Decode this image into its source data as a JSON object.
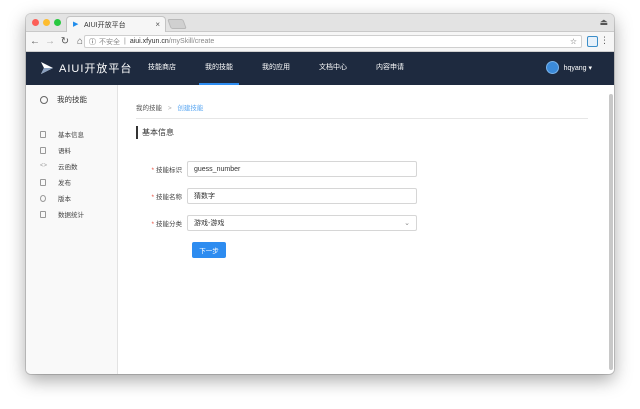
{
  "browser": {
    "tab_title": "AIUI开放平台",
    "tab_close": "×",
    "address": {
      "insecure_label": "不安全",
      "host": "aiui.xfyun.cn",
      "path": "/mySkill/create"
    }
  },
  "header": {
    "logo_text": "AIUI开放平台",
    "nav": [
      "技能商店",
      "我的技能",
      "我的应用",
      "文档中心",
      "内容申请"
    ],
    "active_nav": "我的技能",
    "user": "hqyang ▾"
  },
  "sidebar": {
    "title": "我的技能",
    "items": [
      {
        "label": "基本信息",
        "icon": "document-icon"
      },
      {
        "label": "语料",
        "icon": "corpus-icon"
      },
      {
        "label": "云函数",
        "icon": "code-icon"
      },
      {
        "label": "发布",
        "icon": "publish-icon"
      },
      {
        "label": "版本",
        "icon": "version-icon"
      },
      {
        "label": "数据统计",
        "icon": "stats-icon"
      }
    ]
  },
  "main": {
    "breadcrumb": {
      "parent": "我的技能",
      "sep": ">",
      "current": "创建技能"
    },
    "section_title": "基本信息",
    "form": {
      "required_mark": "*",
      "skill_id_label": "技能标识",
      "skill_id_value": "guess_number",
      "skill_name_label": "技能名称",
      "skill_name_value": "猜数字",
      "skill_category_label": "技能分类",
      "skill_category_value": "游戏-游戏"
    },
    "next_button": "下一步"
  },
  "colors": {
    "header_bg": "#1e2a3f",
    "accent": "#2d8cf0"
  }
}
